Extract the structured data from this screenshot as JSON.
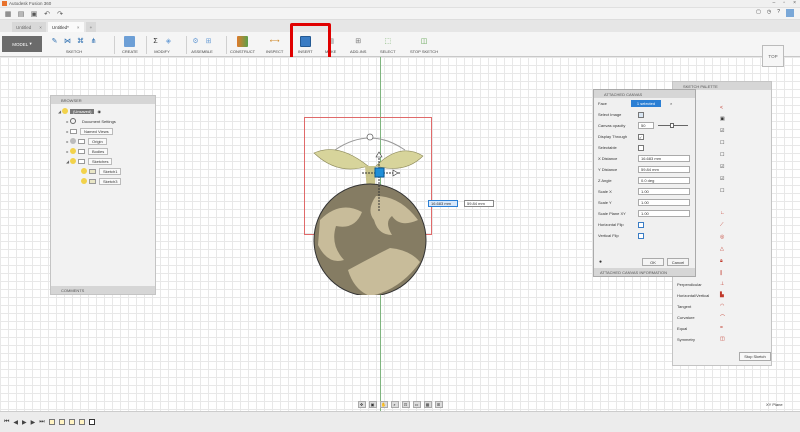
{
  "window": {
    "title": "Autodesk Fusion 360"
  },
  "tabs": [
    {
      "label": "Untitled"
    },
    {
      "label": "Untitled*"
    }
  ],
  "ribbon": {
    "workspace": "MODEL",
    "groups": [
      "SKETCH",
      "CREATE",
      "MODIFY",
      "ASSEMBLE",
      "CONSTRUCT",
      "INSPECT",
      "INSERT",
      "MAKE",
      "ADD-INS",
      "SELECT",
      "STOP SKETCH"
    ]
  },
  "viewcube": {
    "label": "TOP"
  },
  "browser": {
    "title": "BROWSER",
    "root": "(Unsaved)",
    "items": [
      "Document Settings",
      "Named Views",
      "Origin",
      "Bodies",
      "Sketches",
      "Sketch1",
      "Sketch3"
    ],
    "comments": "COMMENTS"
  },
  "dialog": {
    "title": "ATTACHED CANVAS",
    "face_label": "Face",
    "face_value": "1 selected",
    "select_image": "Select Image",
    "opacity_label": "Canvas opacity",
    "opacity_value": "50",
    "display_through": "Display Through",
    "selectable": "Selectable",
    "x_dist_label": "X Distance",
    "x_dist_value": "16.683 mm",
    "y_dist_label": "Y Distance",
    "y_dist_value": "59.84 mm",
    "z_angle_label": "Z Angle",
    "z_angle_value": "0.0 deg",
    "scale_x_label": "Scale X",
    "scale_x_value": "1.00",
    "scale_y_label": "Scale Y",
    "scale_y_value": "1.00",
    "scale_plane_label": "Scale Plane XY",
    "scale_plane_value": "1.00",
    "hflip": "Horizontal Flip",
    "vflip": "Vertical Flip",
    "ok": "OK",
    "cancel": "Cancel",
    "info": "ATTACHED CANVAS INFORMATION"
  },
  "palette": {
    "title": "SKETCH PALETTE",
    "constraints": [
      "Perpendicular",
      "Horizontal/Vertical",
      "Tangent",
      "Curvature",
      "Equal",
      "Symmetry"
    ],
    "stop": "Stop Sketch"
  },
  "sketch": {
    "dim_x": "16.683 mm",
    "dim_y": "59.84 mm"
  },
  "status": {
    "plane": "XY Plane"
  }
}
